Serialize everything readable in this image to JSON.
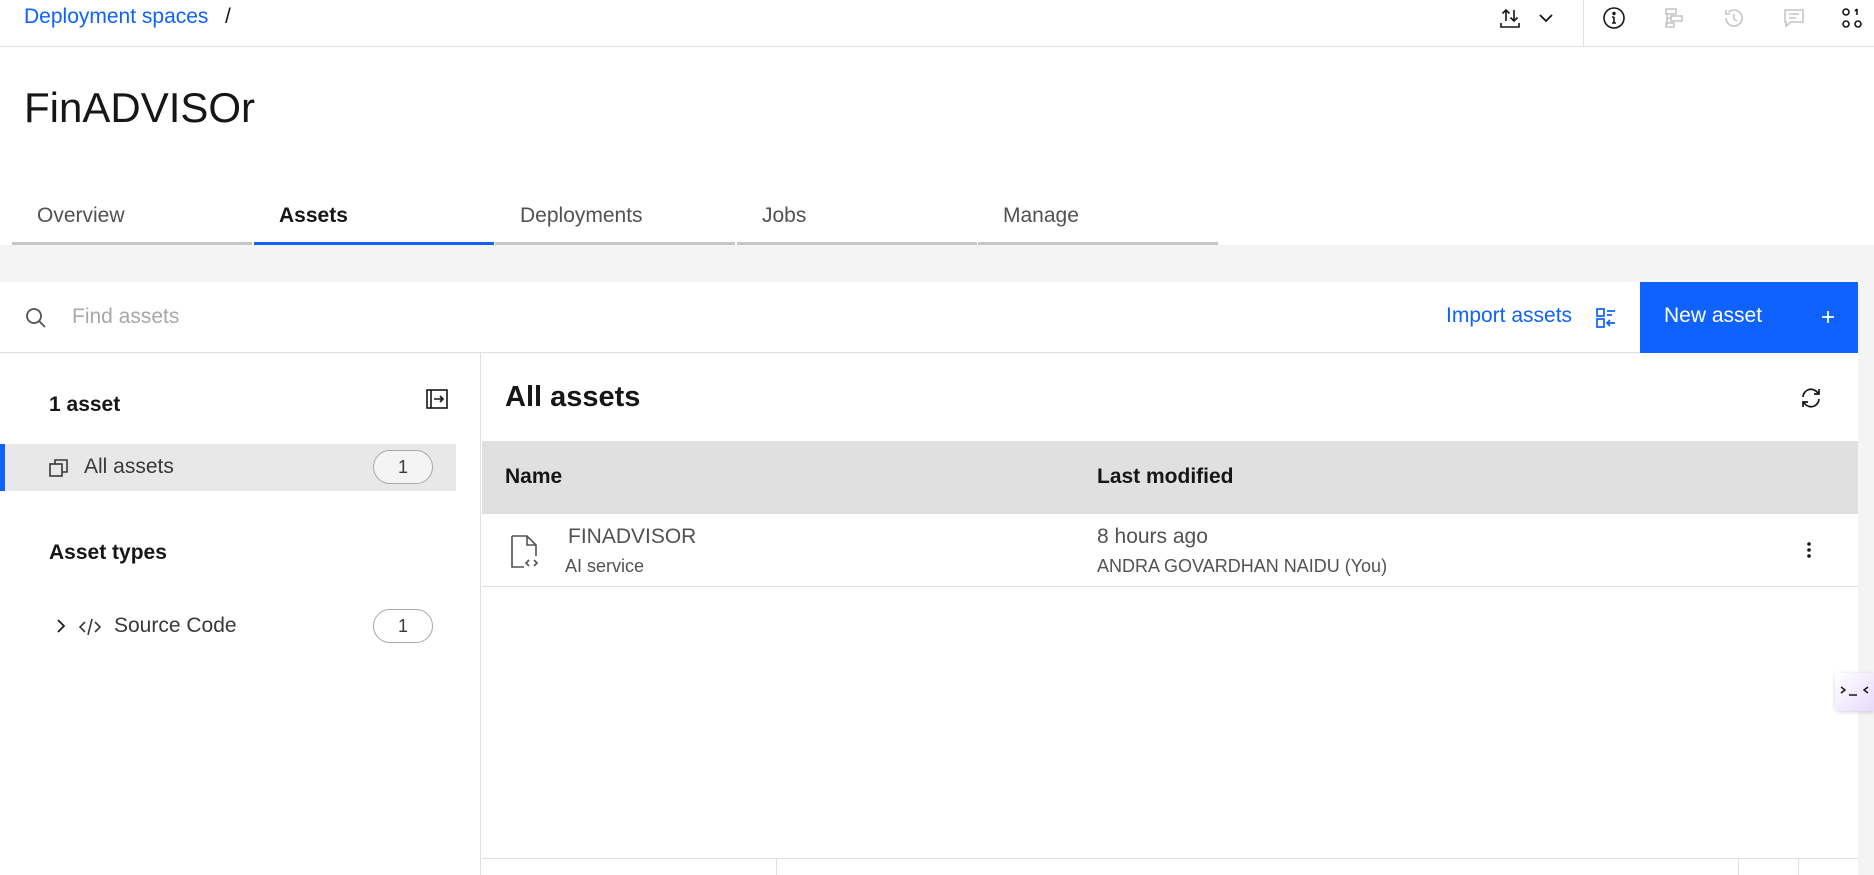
{
  "breadcrumb": {
    "link": "Deployment spaces",
    "separator": "/"
  },
  "page_title": "FinADVISOr",
  "tabs": [
    {
      "label": "Overview",
      "active": false
    },
    {
      "label": "Assets",
      "active": true
    },
    {
      "label": "Deployments",
      "active": false
    },
    {
      "label": "Jobs",
      "active": false
    },
    {
      "label": "Manage",
      "active": false
    }
  ],
  "toolbar_icons": [
    "upload-download-icon",
    "chevron-down-icon",
    "info-icon",
    "lineage-icon",
    "history-icon",
    "comment-icon",
    "apps-icon"
  ],
  "search": {
    "placeholder": "Find assets"
  },
  "actions": {
    "import_label": "Import assets",
    "new_asset_label": "New asset"
  },
  "sidebar": {
    "count_label": "1 asset",
    "all_assets": {
      "label": "All assets",
      "count": "1"
    },
    "types_heading": "Asset types",
    "types": [
      {
        "label": "Source Code",
        "count": "1"
      }
    ]
  },
  "main": {
    "title": "All assets",
    "columns": {
      "name": "Name",
      "modified": "Last modified"
    },
    "rows": [
      {
        "name": "FINADVISOR",
        "type": "AI service",
        "modified": "8 hours ago",
        "modified_by": "ANDRA GOVARDHAN NAIDU (You)"
      }
    ]
  },
  "colors": {
    "accent": "#0f62fe",
    "header_bg": "#e0e0e0",
    "selected_bg": "#e8e8e8",
    "band": "#f4f4f4"
  }
}
